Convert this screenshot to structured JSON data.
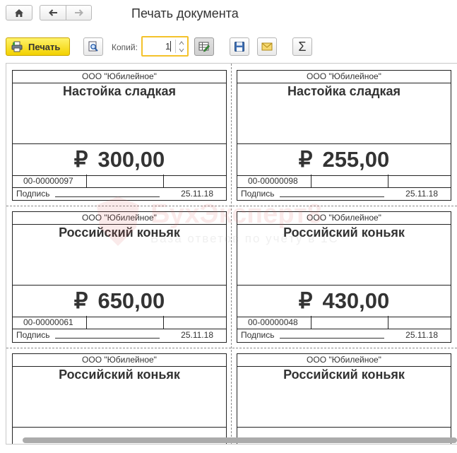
{
  "header": {
    "title": "Печать документа"
  },
  "toolbar": {
    "print_label": "Печать",
    "copies_label": "Копий:",
    "copies_value": "1",
    "sum_label": "Σ"
  },
  "labels": [
    {
      "company": "ООО \"Юбилейное\"",
      "product": "Настойка сладкая",
      "price": "300,00",
      "code": "00-00000097",
      "signature": "Подпись",
      "date": "25.11.18"
    },
    {
      "company": "ООО \"Юбилейное\"",
      "product": "Настойка сладкая",
      "price": "255,00",
      "code": "00-00000098",
      "signature": "Подпись",
      "date": "25.11.18"
    },
    {
      "company": "ООО \"Юбилейное\"",
      "product": "Российский коньяк",
      "price": "650,00",
      "code": "00-00000061",
      "signature": "Подпись",
      "date": "25.11.18"
    },
    {
      "company": "ООО \"Юбилейное\"",
      "product": "Российский коньяк",
      "price": "430,00",
      "code": "00-00000048",
      "signature": "Подпись",
      "date": "25.11.18"
    },
    {
      "company": "ООО \"Юбилейное\"",
      "product": "Российский коньяк"
    },
    {
      "company": "ООО \"Юбилейное\"",
      "product": "Российский коньяк"
    }
  ],
  "currency_symbol": "₽",
  "watermark": {
    "name": "БухЭксперт8",
    "tagline": "База ответов по учёту в 1С"
  },
  "colors": {
    "print_button": "#f2d100",
    "copies_border": "#f4c22b",
    "watermark": "#e06666"
  }
}
